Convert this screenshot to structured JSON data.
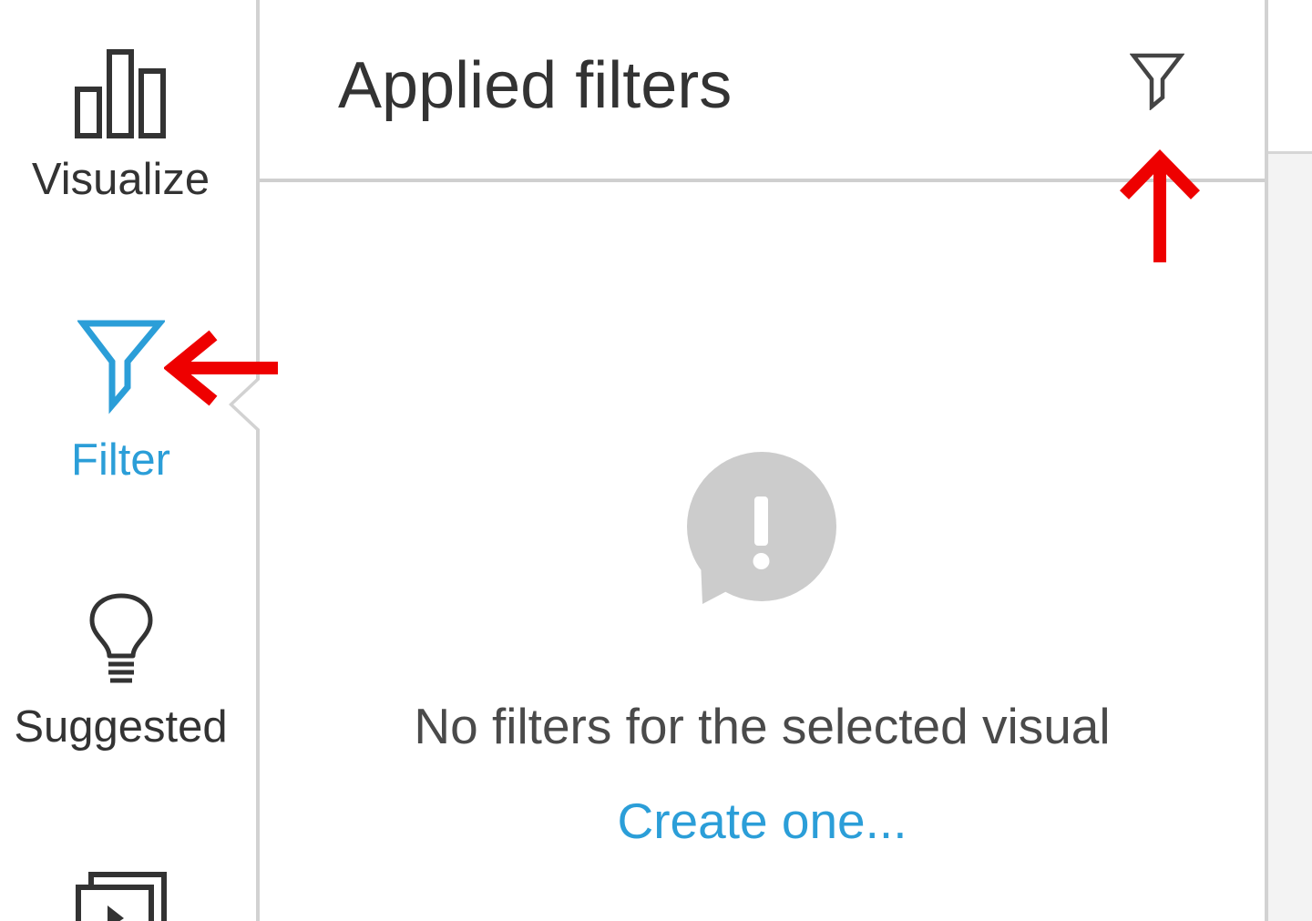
{
  "rail": {
    "items": [
      {
        "label": "Visualize",
        "icon": "bar-chart-icon",
        "active": false
      },
      {
        "label": "Filter",
        "icon": "filter-icon",
        "active": true
      },
      {
        "label": "Suggested",
        "icon": "lightbulb-icon",
        "active": false
      },
      {
        "label": "",
        "icon": "format-pages-icon",
        "active": false
      }
    ]
  },
  "pane": {
    "title": "Applied filters",
    "header_icon": "filter-icon",
    "empty_state": {
      "icon": "alert-bubble-icon",
      "message": "No filters for the selected visual",
      "link": "Create one..."
    }
  },
  "colors": {
    "accent": "#2b9ed8",
    "text": "#333333",
    "muted_icon": "#cccccc",
    "divider": "#d2d2d2",
    "annotation": "#ee0000"
  },
  "annotations": [
    {
      "shape": "arrow",
      "direction": "left",
      "color": "#ee0000"
    },
    {
      "shape": "arrow",
      "direction": "up",
      "color": "#ee0000"
    }
  ]
}
